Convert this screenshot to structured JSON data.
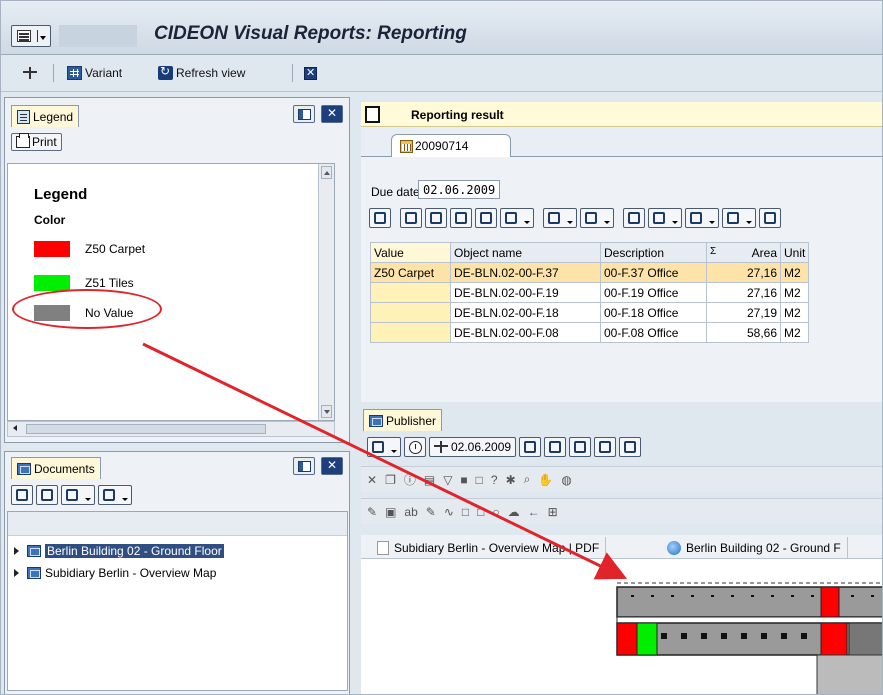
{
  "window": {
    "title": "CIDEON Visual Reports: Reporting"
  },
  "toolbar": {
    "variant_label": "Variant",
    "refresh_label": "Refresh view"
  },
  "legend_panel": {
    "tab_label": "Legend",
    "print_label": "Print",
    "heading": "Legend",
    "subheading": "Color",
    "items": [
      {
        "label": "Z50 Carpet",
        "color": "#ff0000"
      },
      {
        "label": "Z51 Tiles",
        "color": "#00ee00"
      },
      {
        "label": "No Value",
        "color": "#808080"
      }
    ]
  },
  "documents_panel": {
    "tab_label": "Documents",
    "tree": [
      {
        "label": "Berlin Building 02 - Ground Floor",
        "selected": true
      },
      {
        "label": "Subidiary Berlin - Overview Map",
        "selected": false
      }
    ]
  },
  "reporting": {
    "header": "Reporting result",
    "tab_label": "20090714",
    "due_date_label": "Due date",
    "due_date_value": "02.06.2009",
    "columns": [
      "Value",
      "Object name",
      "Description",
      "Area",
      "Unit"
    ],
    "sum_symbol": "Σ",
    "rows": [
      {
        "value": "Z50 Carpet",
        "object": "DE-BLN.02-00-F.37",
        "description": "00-F.37 Office",
        "area": "27,16",
        "unit": "M2"
      },
      {
        "value": "",
        "object": "DE-BLN.02-00-F.19",
        "description": "00-F.19 Office",
        "area": "27,16",
        "unit": "M2"
      },
      {
        "value": "",
        "object": "DE-BLN.02-00-F.18",
        "description": "00-F.18 Office",
        "area": "27,19",
        "unit": "M2"
      },
      {
        "value": "",
        "object": "DE-BLN.02-00-F.08",
        "description": "00-F.08 Office",
        "area": "58,66",
        "unit": "M2"
      }
    ]
  },
  "publisher": {
    "tab_label": "Publisher",
    "date_value": "02.06.2009",
    "doc_tabs": [
      {
        "label": "Subidiary Berlin - Overview Map | PDF"
      },
      {
        "label": "Berlin Building 02 - Ground F"
      }
    ]
  },
  "annotation": {
    "highlight_color": "#e0242a"
  }
}
